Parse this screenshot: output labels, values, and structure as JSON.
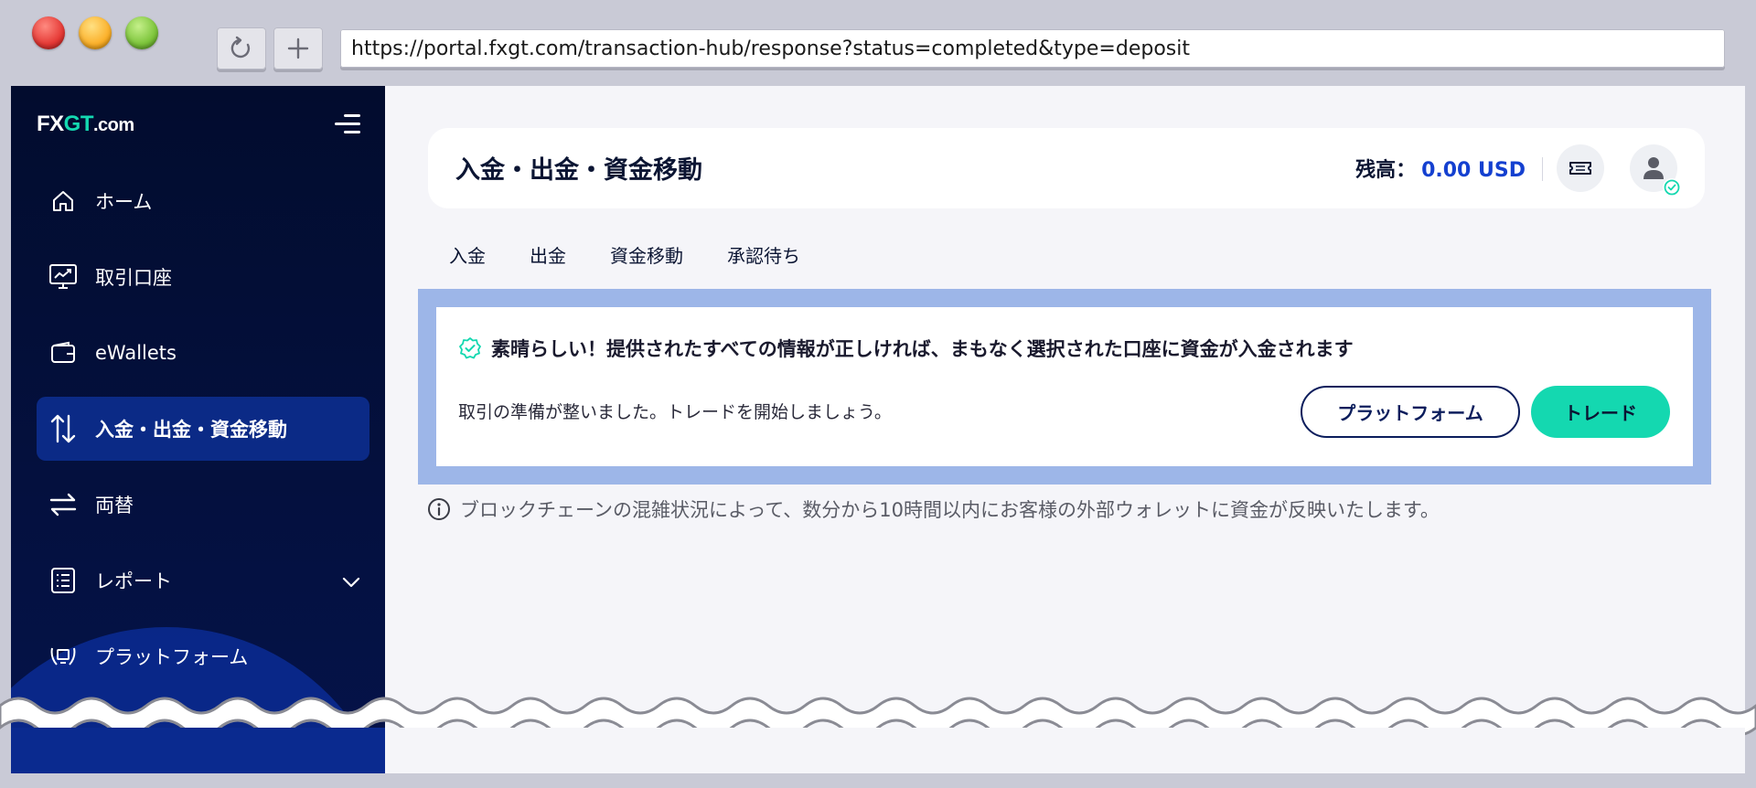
{
  "browser": {
    "url": "https://portal.fxgt.com/transaction-hub/response?status=completed&type=deposit"
  },
  "logo": {
    "fx": "FX",
    "gt": "GT",
    "dom": ".com"
  },
  "sidebar": {
    "items": [
      {
        "label": "ホーム",
        "icon": "home-icon"
      },
      {
        "label": "取引口座",
        "icon": "chart-monitor-icon"
      },
      {
        "label": "eWallets",
        "icon": "wallet-icon"
      },
      {
        "label": "入金・出金・資金移動",
        "icon": "transfer-arrows-icon",
        "active": true
      },
      {
        "label": "両替",
        "icon": "exchange-icon"
      },
      {
        "label": "レポート",
        "icon": "report-list-icon"
      },
      {
        "label": "プラットフォーム",
        "icon": "platform-icon"
      }
    ]
  },
  "header": {
    "title": "入金・出金・資金移動",
    "balance_label": "残高：",
    "balance_amount": "0.00 USD"
  },
  "tabs": [
    {
      "label": "入金"
    },
    {
      "label": "出金"
    },
    {
      "label": "資金移動"
    },
    {
      "label": "承認待ち"
    }
  ],
  "alert": {
    "title": "素晴らしい！提供されたすべての情報が正しければ、まもなく選択された口座に資金が入金されます",
    "subtitle": "取引の準備が整いました。トレードを開始しましょう。",
    "platform_button": "プラットフォーム",
    "trade_button": "トレード"
  },
  "info_note": "ブロックチェーンの混雑状況によって、数分から10時間以内にお客様の外部ウォレットに資金が反映いたします。",
  "colors": {
    "accent": "#14d8b0",
    "brand_navy": "#0b1d5c",
    "balance_blue": "#1440d0",
    "sidebar_bg": "#020c2e"
  }
}
